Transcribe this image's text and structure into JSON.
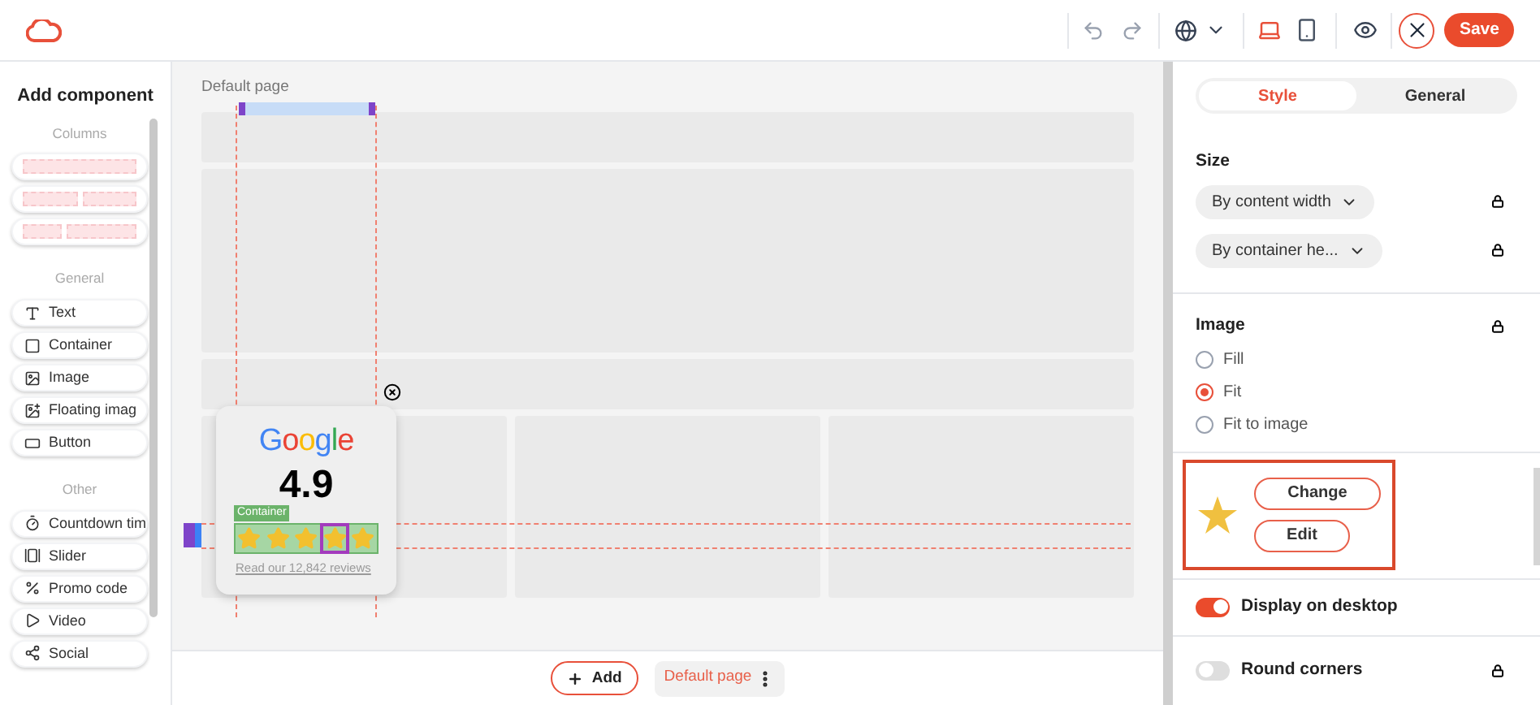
{
  "header": {
    "devices": [
      {
        "kind": "desktop",
        "selected": true
      },
      {
        "kind": "mobile",
        "selected": false
      }
    ],
    "save": "Save"
  },
  "sidebar": {
    "title": "Add component",
    "sections": [
      {
        "title": "Columns",
        "items": [
          {
            "kind": "columns-one"
          },
          {
            "kind": "columns-two"
          },
          {
            "kind": "columns-narrow-wide"
          }
        ]
      },
      {
        "title": "General",
        "items": [
          {
            "kind": "text",
            "label": "Text"
          },
          {
            "kind": "container",
            "label": "Container"
          },
          {
            "kind": "image",
            "label": "Image"
          },
          {
            "kind": "floating-image",
            "label": "Floating imag"
          },
          {
            "kind": "button",
            "label": "Button"
          }
        ]
      },
      {
        "title": "Other",
        "items": [
          {
            "kind": "timer",
            "label": "Countdown tim"
          },
          {
            "kind": "slider",
            "label": "Slider"
          },
          {
            "kind": "promo",
            "label": "Promo code"
          },
          {
            "kind": "video",
            "label": "Video"
          },
          {
            "kind": "social",
            "label": "Social"
          }
        ]
      }
    ]
  },
  "canvas": {
    "page_label": "Default page",
    "widget": {
      "logo": "Google",
      "rating": "4.9",
      "container_tag": "Container",
      "stars": 5,
      "reviews_link": "Read our 12,842 reviews"
    }
  },
  "bottom_bar": {
    "add": "Add",
    "page_tab": "Default page"
  },
  "panel": {
    "tabs": [
      {
        "label": "Style",
        "selected": true
      },
      {
        "label": "General",
        "selected": false
      }
    ],
    "size": {
      "title": "Size",
      "selects": [
        "By content width",
        "By container he..."
      ]
    },
    "image": {
      "title": "Image",
      "options": [
        {
          "label": "Fill",
          "selected": false
        },
        {
          "label": "Fit",
          "selected": true
        },
        {
          "label": "Fit to image",
          "selected": false
        }
      ]
    },
    "image_buttons": [
      "Change",
      "Edit"
    ],
    "toggles": [
      {
        "label": "Display on desktop",
        "on": true,
        "locked": false
      },
      {
        "label": "Round corners",
        "on": false,
        "locked": true
      }
    ]
  }
}
